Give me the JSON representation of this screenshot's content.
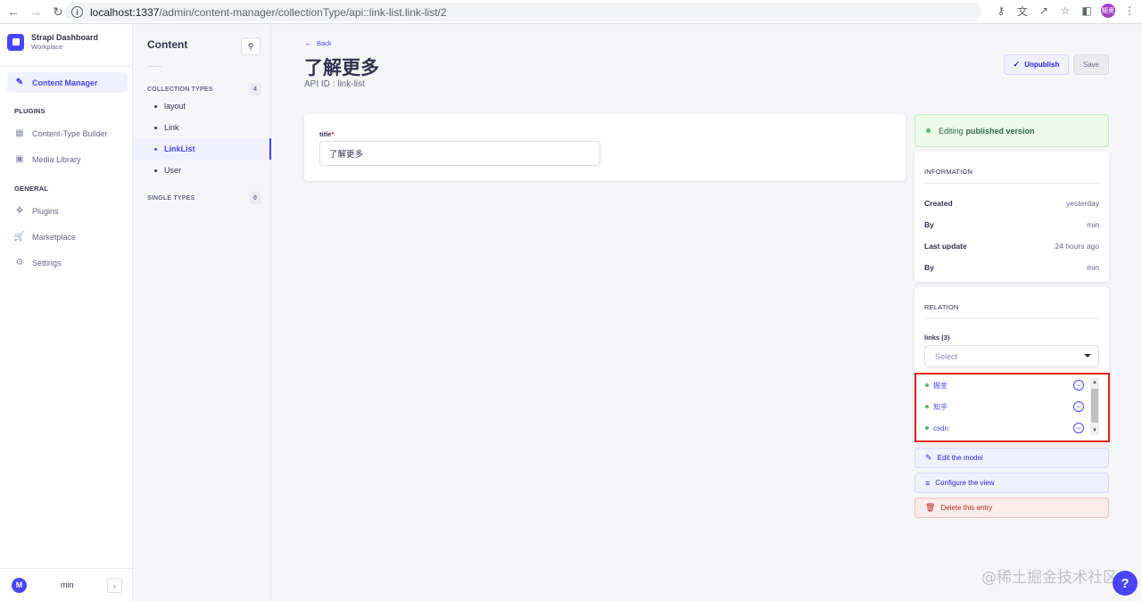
{
  "browser": {
    "url_host": "localhost:1337",
    "url_path": "/admin/content-manager/collectionType/api::link-list.link-list/2",
    "profile_initials": "梗奥"
  },
  "leftnav": {
    "brand_title": "Strapi Dashboard",
    "brand_sub": "Workplace",
    "items": [
      {
        "label": "Content Manager",
        "icon": "pencil-icon"
      },
      {
        "label": "Content-Type Builder",
        "icon": "layout-icon"
      },
      {
        "label": "Media Library",
        "icon": "image-icon"
      },
      {
        "label": "Plugins",
        "icon": "puzzle-icon"
      },
      {
        "label": "Marketplace",
        "icon": "cart-icon"
      },
      {
        "label": "Settings",
        "icon": "gear-icon"
      }
    ],
    "section_plugins": "PLUGINS",
    "section_general": "GENERAL",
    "user_initial": "M",
    "user_name": "min"
  },
  "subnav": {
    "title": "Content",
    "collection_types_label": "COLLECTION TYPES",
    "collection_types_count": "4",
    "collection_types": [
      "layout",
      "Link",
      "LinkList",
      "User"
    ],
    "active": "LinkList",
    "single_types_label": "SINGLE TYPES",
    "single_types_count": "0"
  },
  "main": {
    "back_label": "Back",
    "title": "了解更多",
    "api_id": "API ID : link-list",
    "unpublish_label": "Unpublish",
    "save_label": "Save",
    "field_label": "title",
    "field_required_mark": "*",
    "field_value": "了解更多"
  },
  "sidebar": {
    "status_prefix": "Editing",
    "status_bold": "published version",
    "info_head": "INFORMATION",
    "info_rows": [
      {
        "k": "Created",
        "v": "yesterday"
      },
      {
        "k": "By",
        "v": "min"
      },
      {
        "k": "Last update",
        "v": "24 hours ago"
      },
      {
        "k": "By",
        "v": "min"
      }
    ],
    "relation_head": "RELATION",
    "links_label": "links (3)",
    "select_placeholder": "Select",
    "relations": [
      "掘金",
      "知乎",
      "csdn"
    ],
    "edit_model": "Edit the model",
    "configure_view": "Configure the view",
    "delete_entry": "Delete this entry"
  },
  "watermark": "@稀土掘金技术社区",
  "help": "?"
}
